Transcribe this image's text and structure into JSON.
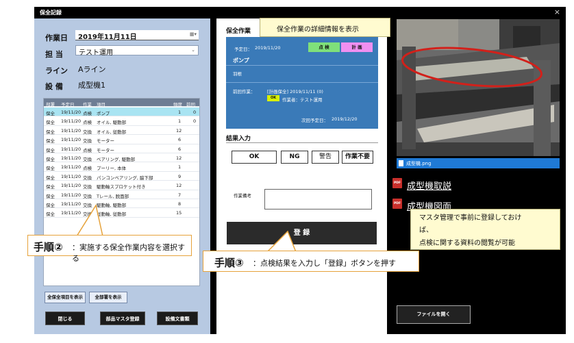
{
  "window": {
    "title": "保全記録",
    "close_glyph": "×"
  },
  "form": {
    "date_label": "作業日",
    "date_value": "2019年11月11日",
    "person_label": "担 当",
    "person_value": "テスト運用",
    "line_label": "ライン",
    "line_value": "Aライン",
    "equipment_label": "設 備",
    "equipment_value": "成型機1"
  },
  "grid": {
    "headers": [
      "部署",
      "予定日",
      "作業",
      "項目",
      "頻度",
      "前回"
    ],
    "rows": [
      [
        "保全",
        "19/11/20",
        "点検",
        "ポンプ",
        "1",
        "0"
      ],
      [
        "保全",
        "19/11/20",
        "点検",
        "オイル, 駆動部",
        "1",
        "0"
      ],
      [
        "保全",
        "19/11/20",
        "交換",
        "オイル, 従動部",
        "12",
        ""
      ],
      [
        "保全",
        "19/11/20",
        "交換",
        "モーター",
        "6",
        ""
      ],
      [
        "保全",
        "19/11/20",
        "点検",
        "モーター",
        "6",
        ""
      ],
      [
        "保全",
        "19/11/20",
        "交換",
        "ベアリング, 駆動部",
        "12",
        ""
      ],
      [
        "保全",
        "19/11/20",
        "点検",
        "プーリー, 本体",
        "1",
        ""
      ],
      [
        "保全",
        "19/11/20",
        "交換",
        "パンコンベアリング, 脇下部",
        "9",
        ""
      ],
      [
        "保全",
        "19/11/20",
        "交換",
        "駆動軸スプロケット付き",
        "12",
        ""
      ],
      [
        "保全",
        "19/11/20",
        "交換",
        "Tレール, 脱面部",
        "7",
        ""
      ],
      [
        "保全",
        "19/11/20",
        "交換",
        "駆動軸, 駆動部",
        "8",
        ""
      ],
      [
        "保全",
        "19/11/20",
        "交換",
        "従動軸, 従動部",
        "15",
        ""
      ]
    ]
  },
  "left_buttons": {
    "show_all_items": "全保全項目を表示",
    "show_all_depts": "全部署を表示",
    "close": "閉じる",
    "parts_master": "部品マスタ登録",
    "equipment_docs": "設備文書類"
  },
  "work_panel": {
    "section_title": "保全作業",
    "scheduled_label": "予定日：",
    "scheduled_value": "2019/11/20",
    "inspect_tag": "点 検",
    "plan_tag": "計 画",
    "item_name": "ポンプ",
    "item_sub": "羽根",
    "prev_work_label": "前回作業：",
    "prev_work_value": "[計画保全] 2019/11/11 (0)",
    "ok_tag": "OK",
    "prev_worker": "作業者：テスト運用",
    "next_label": "次回予定日：",
    "next_value": "2019/12/20"
  },
  "result": {
    "section_title": "結果入力",
    "ok": "OK",
    "ng": "NG",
    "warning": "警告",
    "not_needed": "作業不要",
    "note_label": "作業備考",
    "register": "登 録"
  },
  "files": {
    "image_name": "成型機.png",
    "doc1": "成型機取説",
    "doc2": "成型機図面",
    "open_file": "ファイルを開く"
  },
  "callouts": {
    "detail_note": "保全作業の詳細情報を表示",
    "master_note_1": "マスタ管理で事前に登録しておけ",
    "master_note_2": "ば、",
    "master_note_3": "点検に関する資料の閲覧が可能",
    "step2_big": "手順②",
    "step2_text": "：実施する保全作業内容を選択する",
    "step3_big": "手順③",
    "step3_text": "：点検結果を入力し「登録」ボタンを押す"
  },
  "colors": {
    "left_pane": "#b7c9e2",
    "work_panel": "#3a7ab8",
    "inspect_tag": "#7fe07a",
    "plan_tag": "#f08ff0",
    "selected_row": "#a9e4f2",
    "file_bar": "#1f7ad6",
    "callout_border": "#e6a23a"
  }
}
